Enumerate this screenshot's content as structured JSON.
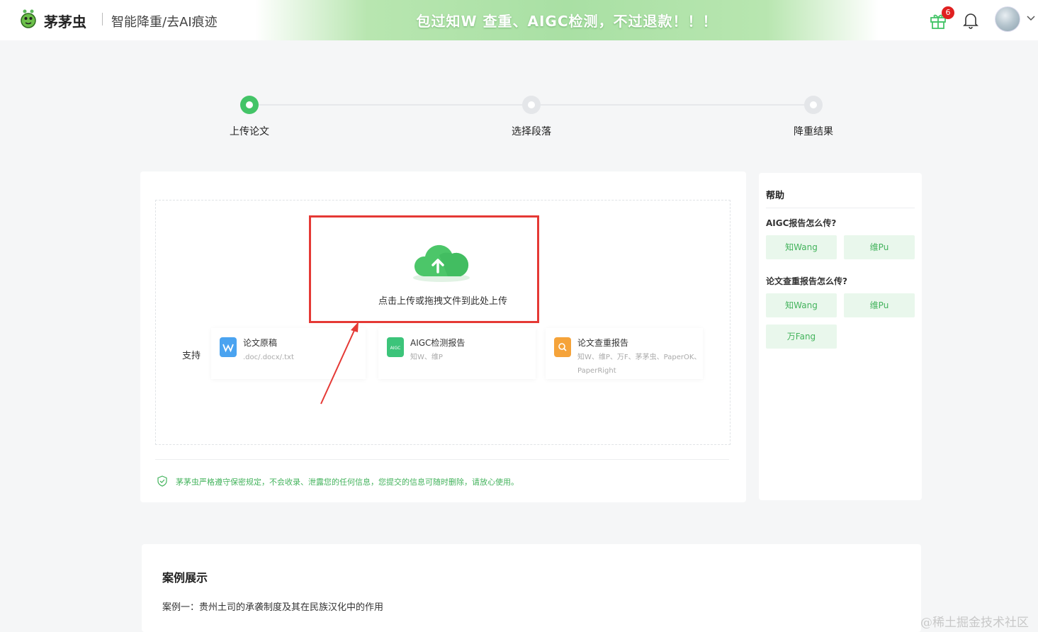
{
  "header": {
    "brand": "茅茅虫",
    "subtitle": "智能降重/去AI痕迹",
    "banner": "包过知W 查重、AIGC检测，不过退款！！！",
    "notification_count": "6"
  },
  "steps": [
    {
      "label": "上传论文",
      "state": "active"
    },
    {
      "label": "选择段落",
      "state": "pending"
    },
    {
      "label": "降重结果",
      "state": "pending"
    }
  ],
  "upload": {
    "prompt": "点击上传或拖拽文件到此处上传",
    "support_label": "支持",
    "types": [
      {
        "title": "论文原稿",
        "desc": ".doc/.docx/.txt",
        "color": "#4aa3f0",
        "icon_text": "W"
      },
      {
        "title": "AIGC检测报告",
        "desc": "知W、维P",
        "color": "#3cc47a",
        "icon_text": "AIGC"
      },
      {
        "title": "论文查重报告",
        "desc": "知W、维P、万F、茅茅虫、PaperOK、PaperRight",
        "color": "#f5a33a",
        "icon_text": "Q"
      }
    ],
    "privacy": "茅茅虫严格遵守保密规定，不会收录、泄露您的任何信息，您提交的信息可随时删除，请放心使用。"
  },
  "help": {
    "title": "帮助",
    "sections": [
      {
        "question": "AIGC报告怎么传?",
        "buttons": [
          "知Wang",
          "维Pu"
        ]
      },
      {
        "question": "论文查重报告怎么传?",
        "buttons": [
          "知Wang",
          "维Pu",
          "万Fang"
        ]
      }
    ]
  },
  "cases": {
    "title": "案例展示",
    "item1": "案例一：贵州土司的承袭制度及其在民族汉化中的作用"
  },
  "watermark": "@稀土掘金技术社区",
  "colors": {
    "accent": "#43c467",
    "highlight": "#e53935"
  }
}
